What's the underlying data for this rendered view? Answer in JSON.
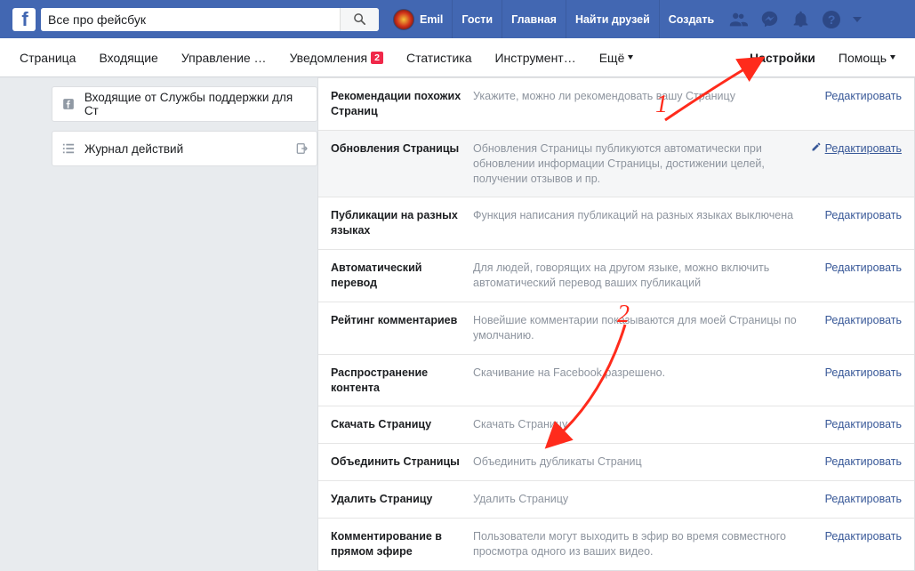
{
  "topbar": {
    "search_value": "Все про фейсбук",
    "user_name": "Emil",
    "links": {
      "guests": "Гости",
      "home": "Главная",
      "find_friends": "Найти друзей",
      "create": "Создать"
    }
  },
  "pagenav": {
    "items": [
      "Страница",
      "Входящие",
      "Управление …",
      "Уведомления",
      "Статистика",
      "Инструмент…",
      "Ещё"
    ],
    "notif_badge": "2",
    "settings": "Настройки",
    "help": "Помощь"
  },
  "sidebar": {
    "inbox_support": "Входящие от Службы поддержки для Ст",
    "activity_log": "Журнал действий"
  },
  "settings_rows": [
    {
      "name": "Рекомендации похожих Страниц",
      "desc": "Укажите, можно ли рекомендовать вашу Страницу",
      "edit": "Редактировать",
      "highlight": false
    },
    {
      "name": "Обновления Страницы",
      "desc": "Обновления Страницы публикуются автоматически при обновлении информации Страницы, достижении целей, получении отзывов и пр.",
      "edit": "Редактировать",
      "highlight": true,
      "underline": true,
      "pencil": true
    },
    {
      "name": "Публикации на разных языках",
      "desc": "Функция написания публикаций на разных языках выключена",
      "edit": "Редактировать",
      "highlight": false
    },
    {
      "name": "Автоматический перевод",
      "desc": "Для людей, говорящих на другом языке, можно включить автоматический перевод ваших публикаций",
      "edit": "Редактировать",
      "highlight": false
    },
    {
      "name": "Рейтинг комментариев",
      "desc": "Новейшие комментарии показываются для моей Страницы по умолчанию.",
      "edit": "Редактировать",
      "highlight": false
    },
    {
      "name": "Распространение контента",
      "desc": "Скачивание на Facebook разрешено.",
      "edit": "Редактировать",
      "highlight": false
    },
    {
      "name": "Скачать Страницу",
      "desc": "Скачать Страницу",
      "edit": "Редактировать",
      "highlight": false
    },
    {
      "name": "Объединить Страницы",
      "desc": "Объединить дубликаты Страниц",
      "edit": "Редактировать",
      "highlight": false
    },
    {
      "name": "Удалить Страницу",
      "desc": "Удалить Страницу",
      "edit": "Редактировать",
      "highlight": false
    },
    {
      "name": "Комментирование в прямом эфире",
      "desc": "Пользователи могут выходить в эфир во время совместного просмотра одного из ваших видео.",
      "edit": "Редактировать",
      "highlight": false
    }
  ],
  "annotations": {
    "num1": "1",
    "num2": "2"
  }
}
